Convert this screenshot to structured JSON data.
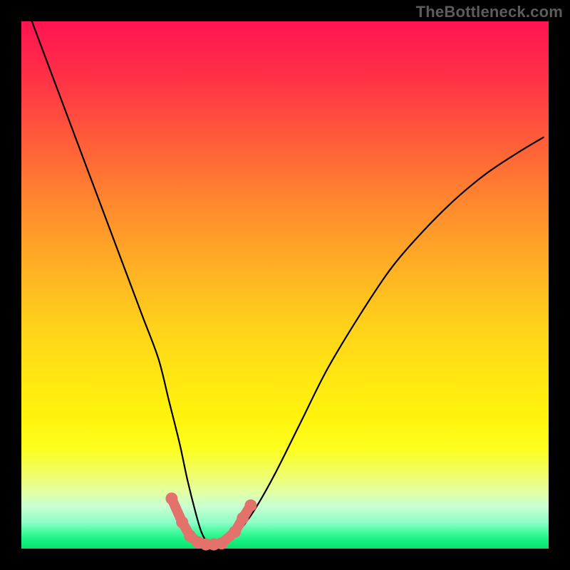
{
  "watermark": "TheBottleneck.com",
  "chart_data": {
    "type": "line",
    "title": "",
    "xlabel": "",
    "ylabel": "",
    "xlim": [
      0,
      100
    ],
    "ylim": [
      0,
      100
    ],
    "grid": false,
    "legend": false,
    "background_gradient_top": "#ff1452",
    "background_gradient_bottom": "#0be16e",
    "series": [
      {
        "name": "bottleneck-curve",
        "color": "#000000",
        "x": [
          2,
          5,
          8,
          11,
          14,
          17,
          20,
          23,
          26,
          28,
          30,
          31.5,
          33,
          34.2,
          35.5,
          37,
          39,
          41,
          44,
          48,
          53,
          58,
          64,
          70,
          76,
          82,
          88,
          94,
          99
        ],
        "y": [
          100,
          92,
          84,
          76,
          68,
          60,
          52,
          44,
          36,
          28,
          20,
          13,
          7,
          3,
          1,
          0.8,
          1.2,
          3,
          7,
          14,
          24,
          34,
          44,
          53,
          60,
          66,
          71,
          75,
          78
        ]
      }
    ],
    "markers": {
      "name": "highlight-points",
      "color": "#e2726b",
      "points": [
        {
          "x": 28.5,
          "y": 9.5
        },
        {
          "x": 30.5,
          "y": 5.0
        },
        {
          "x": 32.0,
          "y": 2.4
        },
        {
          "x": 33.5,
          "y": 1.2
        },
        {
          "x": 35.0,
          "y": 0.8
        },
        {
          "x": 36.5,
          "y": 0.8
        },
        {
          "x": 38.0,
          "y": 1.0
        },
        {
          "x": 40.5,
          "y": 3.2
        },
        {
          "x": 42.0,
          "y": 5.8
        },
        {
          "x": 43.5,
          "y": 8.2
        }
      ]
    }
  }
}
